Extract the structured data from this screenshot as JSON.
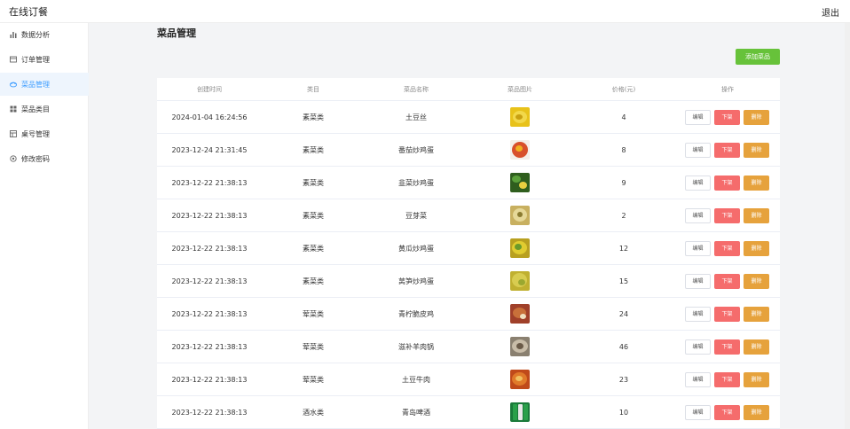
{
  "app": {
    "title": "在线订餐",
    "logout": "退出"
  },
  "sidebar": {
    "items": [
      {
        "label": "数据分析",
        "icon": "bar-chart-icon",
        "active": false
      },
      {
        "label": "订单管理",
        "icon": "order-icon",
        "active": false
      },
      {
        "label": "菜品管理",
        "icon": "dish-icon",
        "active": true
      },
      {
        "label": "菜品类目",
        "icon": "grid-icon",
        "active": false
      },
      {
        "label": "桌号管理",
        "icon": "table-icon",
        "active": false
      },
      {
        "label": "修改密码",
        "icon": "settings-icon",
        "active": false
      }
    ]
  },
  "main": {
    "title": "菜品管理",
    "add_button": "添加菜品",
    "columns": [
      "创建时间",
      "类目",
      "菜品名称",
      "菜品图片",
      "价格(元)",
      "操作"
    ],
    "actions": {
      "edit": "编辑",
      "off": "下架",
      "delete": "删除"
    },
    "rows": [
      {
        "created": "2024-01-04 16:24:56",
        "category": "素菜类",
        "name": "土豆丝",
        "price": "4"
      },
      {
        "created": "2023-12-24 21:31:45",
        "category": "素菜类",
        "name": "番茄炒鸡蛋",
        "price": "8"
      },
      {
        "created": "2023-12-22 21:38:13",
        "category": "素菜类",
        "name": "韭菜炒鸡蛋",
        "price": "9"
      },
      {
        "created": "2023-12-22 21:38:13",
        "category": "素菜类",
        "name": "豆芽菜",
        "price": "2"
      },
      {
        "created": "2023-12-22 21:38:13",
        "category": "素菜类",
        "name": "黄瓜炒鸡蛋",
        "price": "12"
      },
      {
        "created": "2023-12-22 21:38:13",
        "category": "素菜类",
        "name": "莴笋炒鸡蛋",
        "price": "15"
      },
      {
        "created": "2023-12-22 21:38:13",
        "category": "荤菜类",
        "name": "青柠脆皮鸡",
        "price": "24"
      },
      {
        "created": "2023-12-22 21:38:13",
        "category": "荤菜类",
        "name": "滋补羊肉锅",
        "price": "46"
      },
      {
        "created": "2023-12-22 21:38:13",
        "category": "荤菜类",
        "name": "土豆牛肉",
        "price": "23"
      },
      {
        "created": "2023-12-22 21:38:13",
        "category": "酒水类",
        "name": "青岛啤酒",
        "price": "10"
      }
    ]
  },
  "colors": {
    "accent": "#409eff",
    "add": "#67c23a",
    "off": "#f56c6c",
    "delete": "#e6a23c"
  }
}
